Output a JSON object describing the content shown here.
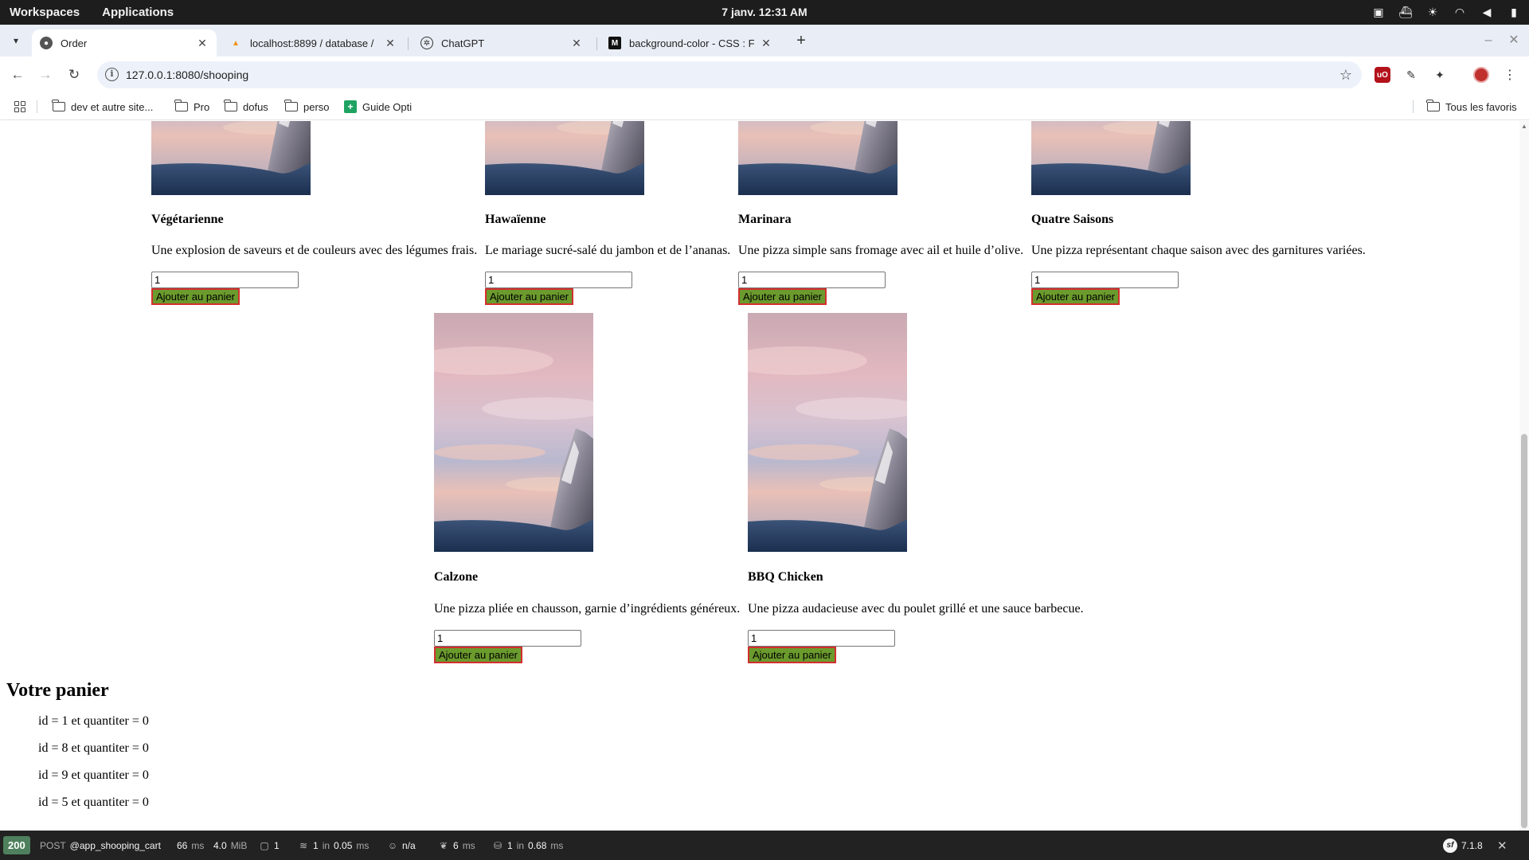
{
  "system_bar": {
    "workspaces": "Workspaces",
    "applications": "Applications",
    "clock": "7 janv.  12:31 AM"
  },
  "tabs": [
    {
      "title": "Order",
      "active": true,
      "icon": "order-favicon"
    },
    {
      "title": "localhost:8899 / database /",
      "active": false,
      "icon": "phpmyadmin-favicon"
    },
    {
      "title": "ChatGPT",
      "active": false,
      "icon": "chatgpt-favicon"
    },
    {
      "title": "background-color - CSS : Feu",
      "active": false,
      "icon": "mdn-favicon"
    }
  ],
  "address_bar": {
    "url": "127.0.0.1:8080/shooping"
  },
  "bookmarks": [
    {
      "label": "dev et autre site...",
      "icon": "folder-icon"
    },
    {
      "label": "Pro",
      "icon": "folder-icon"
    },
    {
      "label": "dofus",
      "icon": "folder-icon"
    },
    {
      "label": "perso",
      "icon": "folder-icon"
    },
    {
      "label": "Guide Opti",
      "icon": "sheets-icon"
    }
  ],
  "all_bookmarks": "Tous les favoris",
  "products": [
    {
      "name": "Végétarienne",
      "description": "Une explosion de saveurs et de couleurs avec des légumes frais.",
      "quantity": "1",
      "button": "Ajouter au panier"
    },
    {
      "name": "Hawaïenne",
      "description": "Le mariage sucré-salé du jambon et de l’ananas.",
      "quantity": "1",
      "button": "Ajouter au panier"
    },
    {
      "name": "Marinara",
      "description": "Une pizza simple sans fromage avec ail et huile d’olive.",
      "quantity": "1",
      "button": "Ajouter au panier"
    },
    {
      "name": "Quatre Saisons",
      "description": "Une pizza représentant chaque saison avec des garnitures variées.",
      "quantity": "1",
      "button": "Ajouter au panier"
    },
    {
      "name": "Calzone",
      "description": "Une pizza pliée en chausson, garnie d’ingrédients généreux.",
      "quantity": "1",
      "button": "Ajouter au panier"
    },
    {
      "name": "BBQ Chicken",
      "description": "Une pizza audacieuse avec du poulet grillé et une sauce barbecue.",
      "quantity": "1",
      "button": "Ajouter au panier"
    }
  ],
  "cart": {
    "title": "Votre panier",
    "lines": [
      "id = 1 et quantiter = 0",
      "id = 8 et quantiter = 0",
      "id = 9 et quantiter = 0",
      "id = 5 et quantiter = 0"
    ]
  },
  "debug_toolbar": {
    "status": "200",
    "method": "POST",
    "route": "@app_shooping_cart",
    "time_value": "66",
    "time_unit": "ms",
    "memory_value": "4.0",
    "memory_unit": "MiB",
    "forms": "1",
    "cache_count": "1",
    "cache_in": "in",
    "cache_time": "0.05",
    "cache_unit": "ms",
    "user": "n/a",
    "twig_time": "6",
    "twig_unit": "ms",
    "db_count": "1",
    "db_in": "in",
    "db_time": "0.68",
    "db_unit": "ms",
    "version": "7.1.8"
  },
  "colors": {
    "add_button_bg": "#6b9a2d",
    "add_button_border": "#d32f2f",
    "status_ok": "#4f805d"
  }
}
